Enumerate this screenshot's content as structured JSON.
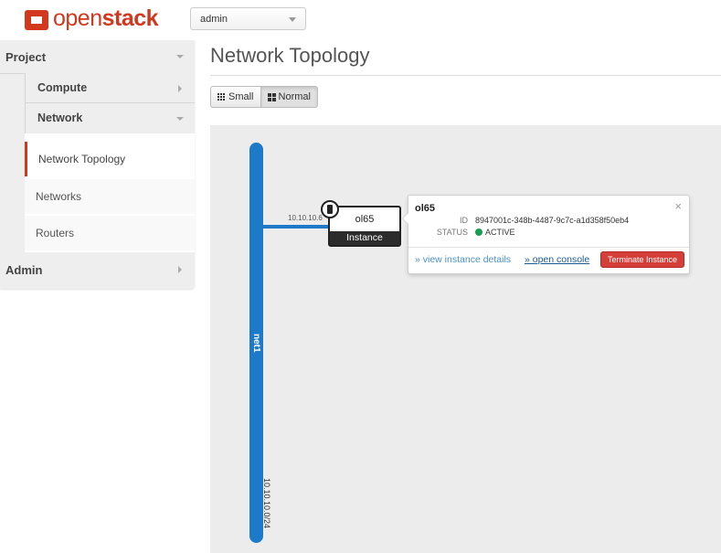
{
  "brand": {
    "logo_prefix": "open",
    "logo_suffix": "stack",
    "accent": "#d3371e"
  },
  "header": {
    "project_selector_value": "admin"
  },
  "sidebar": {
    "panels": [
      {
        "label": "Project",
        "state": "expanded"
      },
      {
        "label": "Admin",
        "state": "collapsed"
      }
    ],
    "project_groups": [
      {
        "label": "Compute",
        "state": "collapsed"
      },
      {
        "label": "Network",
        "state": "expanded"
      }
    ],
    "network_items": [
      {
        "label": "Network Topology",
        "active": true
      },
      {
        "label": "Networks",
        "active": false
      },
      {
        "label": "Routers",
        "active": false
      }
    ]
  },
  "main": {
    "title": "Network Topology",
    "view_buttons": [
      {
        "label": "Small",
        "icon": "grid-icon",
        "active": false
      },
      {
        "label": "Normal",
        "icon": "four-squares-icon",
        "active": true
      }
    ]
  },
  "topology": {
    "network": {
      "name": "net1",
      "cidr": "10.10.10.0/24",
      "color": "#1c7ac9"
    },
    "port_ip": "10.10.10.6",
    "instance": {
      "name": "ol65",
      "type_label": "Instance",
      "icon": "server-icon"
    },
    "balloon": {
      "title": "ol65",
      "id_label": "ID",
      "id_value": "8947001c-348b-4487-9c7c-a1d358f50eb4",
      "status_label": "STATUS",
      "status_value": "ACTIVE",
      "status_color": "#1a9e55",
      "close_glyph": "×",
      "link_details": "» view instance details",
      "link_console": "» open console",
      "terminate_label": "Terminate Instance",
      "terminate_color": "#d43f3a"
    }
  }
}
